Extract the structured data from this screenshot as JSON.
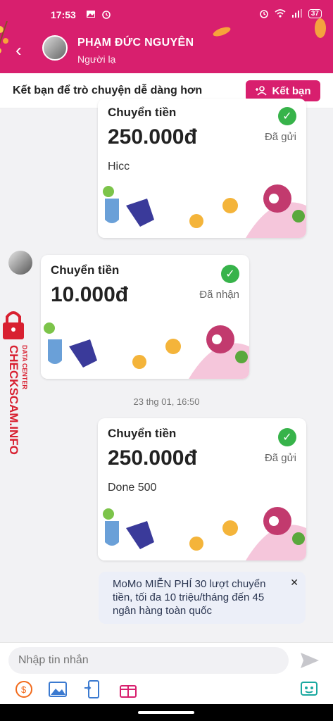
{
  "status": {
    "time": "17:53",
    "battery": "37"
  },
  "header": {
    "name": "PHẠM ĐỨC NGUYÊN",
    "subtitle": "Người lạ"
  },
  "friend_bar": {
    "text": "Kết bạn để trò chuyện dễ dàng hơn",
    "button": "Kết bạn"
  },
  "messages": [
    {
      "title": "Chuyển tiền",
      "amount": "250.000đ",
      "state": "Đã gửi",
      "note": "Hicc"
    },
    {
      "title": "Chuyển tiền",
      "amount": "10.000đ",
      "state": "Đã nhận",
      "note": ""
    },
    {
      "title": "Chuyển tiền",
      "amount": "250.000đ",
      "state": "Đã gửi",
      "note": "Done 500"
    }
  ],
  "timestamp": "23 thg 01, 16:50",
  "promo": {
    "text": "MoMo MIỄN PHÍ 30 lượt chuyển tiền, tối đa 10 triệu/tháng đến 45 ngân hàng toàn quốc"
  },
  "composer": {
    "placeholder": "Nhập tin nhắn"
  },
  "watermark": {
    "top": "DATA CENTER",
    "main": "CHECKSCAM.INFO"
  },
  "colors": {
    "brand": "#d81f6e",
    "check": "#37b34a",
    "promo_bg": "#eceff8"
  },
  "icons": [
    "image-icon",
    "alarm-icon",
    "wifi-icon",
    "signal-icon",
    "back-icon",
    "add-friend-icon",
    "check-icon",
    "close-icon",
    "send-icon",
    "money-icon",
    "gallery-icon",
    "transfer-icon",
    "gift-icon",
    "sticker-icon",
    "lock-icon"
  ]
}
